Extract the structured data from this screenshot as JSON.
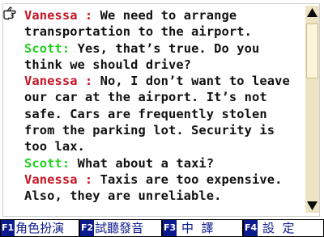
{
  "dialogue": [
    {
      "speaker": "Vanessa",
      "sep": " : ",
      "text": "We need to arrange"
    },
    {
      "speaker": "",
      "sep": "",
      "text": "transportation to the airport."
    },
    {
      "speaker": "Scott",
      "sep": ": ",
      "text": "Yes, that’s true. Do you"
    },
    {
      "speaker": "",
      "sep": "",
      "text": "think we should drive?"
    },
    {
      "speaker": "Vanessa",
      "sep": " : ",
      "text": "No, I don’t want to leave"
    },
    {
      "speaker": "",
      "sep": "",
      "text": "our car at the airport. It’s not"
    },
    {
      "speaker": "",
      "sep": "",
      "text": "safe. Cars are frequently stolen"
    },
    {
      "speaker": "",
      "sep": "",
      "text": "from the parking lot. Security is"
    },
    {
      "speaker": "",
      "sep": "",
      "text": "too lax."
    },
    {
      "speaker": "Scott",
      "sep": ": ",
      "text": "What about a taxi?"
    },
    {
      "speaker": "Vanessa",
      "sep": " : ",
      "text": "Taxis are too expensive."
    },
    {
      "speaker": "",
      "sep": "",
      "text": "Also, they are unreliable."
    }
  ],
  "colors": {
    "vanessa": "#c41424",
    "scott": "#1fd11f",
    "fkey_tag_bg": "#0b1a8c",
    "fkey_label": "#0d1b8d",
    "scrollbar_track": "#ede3c2"
  },
  "icons": {
    "pointer": "pointing-hand-icon",
    "scroll_up": "scroll-up-arrow-icon",
    "scroll_down": "scroll-down-arrow-icon"
  },
  "fkeys": [
    {
      "key": "F1",
      "label": "角色扮演"
    },
    {
      "key": "F2",
      "label": "試聽發音"
    },
    {
      "key": "F3",
      "label": " 中  譯"
    },
    {
      "key": "F4",
      "label": " 設  定"
    }
  ]
}
